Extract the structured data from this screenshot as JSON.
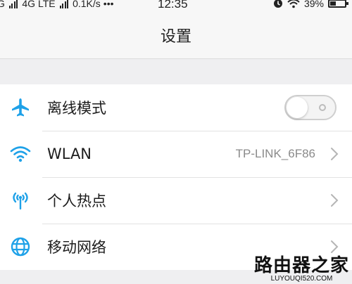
{
  "status_bar": {
    "carrier_signal": "G",
    "network_type": "4G LTE",
    "speed": "0.1K/s",
    "overflow": "•••",
    "time": "12:35",
    "battery": "39%",
    "battery_level_percent": 39
  },
  "header": {
    "title": "设置"
  },
  "settings": {
    "items": [
      {
        "icon": "airplane-icon",
        "label": "离线模式",
        "control": "toggle",
        "toggle_on": false
      },
      {
        "icon": "wifi-icon",
        "label": "WLAN",
        "value": "TP-LINK_6F86",
        "control": "chevron"
      },
      {
        "icon": "hotspot-icon",
        "label": "个人热点",
        "control": "chevron"
      },
      {
        "icon": "globe-icon",
        "label": "移动网络",
        "control": "chevron"
      }
    ]
  },
  "watermark": {
    "title": "路由器之家",
    "url": "LUYOUQI520.COM"
  },
  "colors": {
    "accent": "#1ea1e8",
    "background": "#efeff1",
    "row_background": "#ffffff",
    "text": "#1c1c1c",
    "secondary_text": "#8a8a8a"
  }
}
